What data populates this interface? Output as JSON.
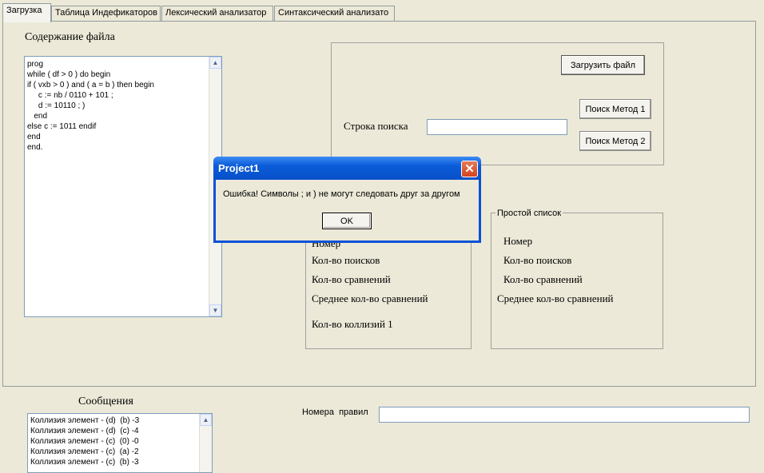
{
  "tabs": [
    "Загрузка",
    "Таблица Индефикаторов",
    "Лексический анализатор",
    "Синтаксический анализато"
  ],
  "file": {
    "title": "Содержание файла",
    "content": "prog\nwhile ( df > 0 ) do begin\nif ( vxb > 0 ) and ( a = b ) then begin\n     c := nb / 0110 + 101 ;\n     d := 10110 ; )\n   end\nelse c := 1011 endif\nend\nend."
  },
  "load_button": "Загрузить файл",
  "search": {
    "label": "Строка поиска",
    "value": "",
    "method1": "Поиск Метод 1",
    "method2": "Поиск Метод 2"
  },
  "hash_group": {
    "partial_label": "Номер",
    "searches": "Кол-во поисков",
    "comparisons": "Кол-во сравнений",
    "avg": "Среднее кол-во сравнений",
    "collisions": "Кол-во коллизий 1"
  },
  "simple_group": {
    "title": "Простой список",
    "number": "Номер",
    "searches": "Кол-во поисков",
    "comparisons": "Кол-во сравнений",
    "avg": "Среднее кол-во сравнений"
  },
  "messages": {
    "title": "Сообщения",
    "lines": "Коллизия элемент - (d)  (b) -3\nКоллизия элемент - (d)  (c) -4\nКоллизия элемент - (c)  (0) -0\nКоллизия элемент - (c)  (a) -2\nКоллизия элемент - (c)  (b) -3"
  },
  "rules": {
    "label": "Номера  правил",
    "value": ""
  },
  "dialog": {
    "title": "Project1",
    "message": "Ошибка! Символы ; и ) не могут следовать друг за другом",
    "ok": "OK"
  }
}
